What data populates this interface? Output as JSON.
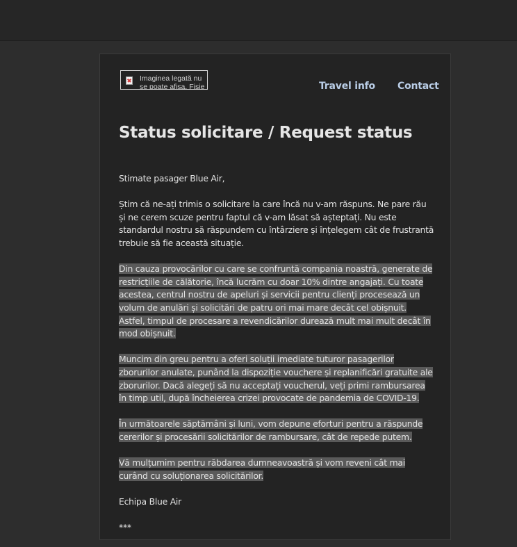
{
  "header": {
    "logo_alt": "Imaginea legată nu se poate afișa. Fișie",
    "nav": {
      "travel_info": "Travel info",
      "contact": "Contact"
    }
  },
  "email": {
    "title": "Status solicitare / Request status",
    "greeting": "Stimate pasager Blue Air,",
    "paragraphs": [
      "Știm că ne-ați trimis o solicitare la care încă nu v-am răspuns. Ne pare rău și ne cerem scuze pentru faptul că v-am lăsat să așteptați. Nu este standardul nostru să răspundem cu întârziere și înțelegem cât de frustrantă trebuie să fie această situație.",
      "Din cauza provocărilor cu care se confruntă compania noastră, generate de restricțiile de călătorie, încă lucrăm cu doar 10% dintre angajați. Cu toate acestea, centrul nostru de apeluri și servicii pentru clienți procesează un volum de anulări și solicitări de patru ori mai mare decât cel obișnuit. Astfel, timpul de procesare a revendicărilor durează mult mai mult decât în mod obișnuit.",
      "Muncim din greu pentru a oferi soluții imediate tuturor pasagerilor zborurilor anulate, punând la dispoziție vouchere și replanificări gratuite ale zborurilor. Dacă alegeți să nu acceptați voucherul, veți primi rambursarea în timp util, după încheierea crizei provocate de pandemia de COVID-19.",
      "În următoarele săptămâni și luni, vom depune eforturi pentru a răspunde cererilor și procesării solicitărilor de rambursare, cât de repede putem.",
      "Vă mulțumim pentru răbdarea dumneavoastră și vom reveni cât mai curând cu soluționarea solicitărilor."
    ],
    "signature": "Echipa Blue Air",
    "separator": "***"
  },
  "colors": {
    "page_bg": "#2d2d2d",
    "top_bar": "#262626",
    "card_bg": "#232323",
    "nav_link": "#b9cde6",
    "selection": "#5a5a5a"
  }
}
